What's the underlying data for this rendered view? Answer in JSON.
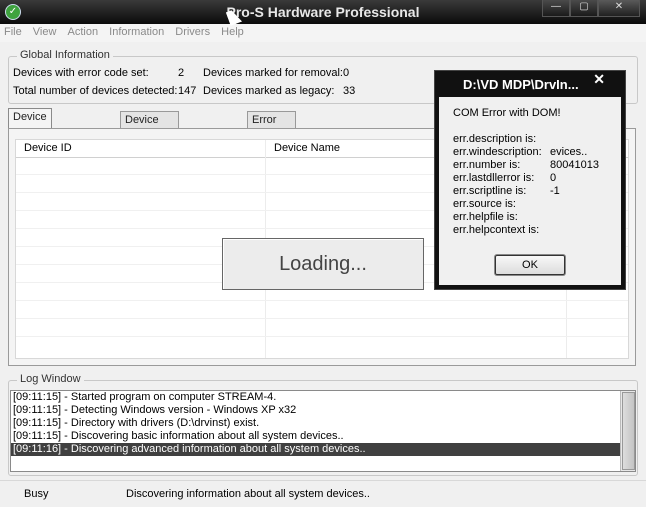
{
  "window": {
    "title": "Pro-S Hardware Professional",
    "icon": "app-check-icon"
  },
  "menu": [
    "File",
    "View",
    "Action",
    "Information",
    "Drivers",
    "Help"
  ],
  "global_info": {
    "label": "Global Information",
    "error_code_label": "Devices with error code set:",
    "error_code_value": "2",
    "total_label": "Total number of devices detected:",
    "total_value": "147",
    "removal_label": "Devices marked for removal:",
    "removal_value": "0",
    "legacy_label": "Devices marked as legacy:",
    "legacy_value": "33"
  },
  "tabs": [
    "Device Simple View",
    "Device Advanced View",
    "Error Devices View"
  ],
  "active_tab": "Device Simple View",
  "grid": {
    "columns": [
      "Device ID",
      "Device Name"
    ]
  },
  "loading": "Loading...",
  "log": {
    "label": "Log Window",
    "lines": [
      "[09:11:15] - Started program on computer STREAM-4.",
      "[09:11:15] - Detecting Windows version - Windows XP x32",
      "[09:11:15] - Directory with drivers (D:\\drvinst) exist.",
      "[09:11:15] - Discovering basic information about all system devices..",
      "[09:11:16] - Discovering advanced information about all system devices.."
    ]
  },
  "status": {
    "state": "Busy",
    "message": "Discovering information about all system devices.."
  },
  "dialog": {
    "title": "D:\\VD MDP\\DrvIn...",
    "message": "COM Error with DOM!",
    "rows": [
      {
        "label": "err.description is:",
        "value": ""
      },
      {
        "label": "err.windescription:",
        "value": "evices.."
      },
      {
        "label": "err.number is:",
        "value": "80041013"
      },
      {
        "label": "err.lastdllerror is:",
        "value": "0"
      },
      {
        "label": "err.scriptline is:",
        "value": "-1"
      },
      {
        "label": "err.source is:",
        "value": ""
      },
      {
        "label": "err.helpfile is:",
        "value": ""
      },
      {
        "label": "err.helpcontext is:",
        "value": ""
      }
    ],
    "ok_label": "OK"
  }
}
